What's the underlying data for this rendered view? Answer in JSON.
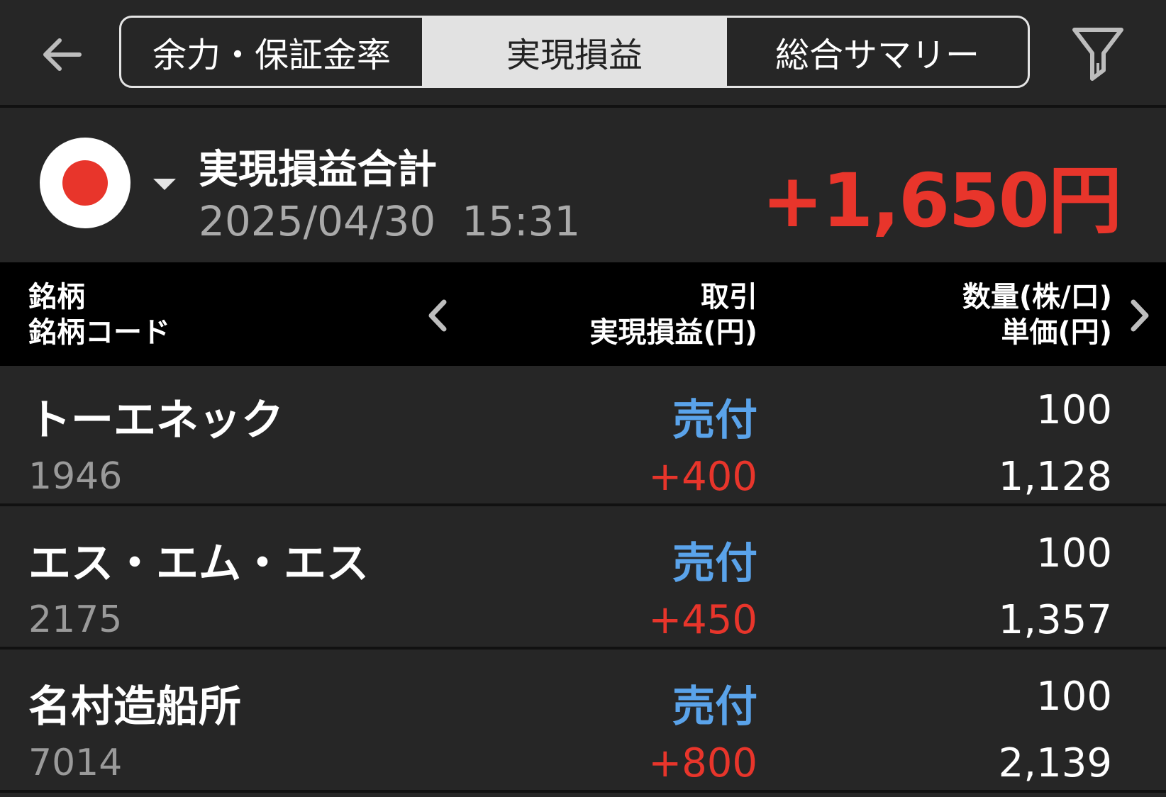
{
  "tabs": [
    {
      "label": "余力・保証金率",
      "active": false
    },
    {
      "label": "実現損益",
      "active": true
    },
    {
      "label": "総合サマリー",
      "active": false
    }
  ],
  "summary": {
    "market_flag": "japan-flag-icon",
    "title": "実現損益合計",
    "datetime": "2025/04/30  15:31",
    "total": "+1,650円"
  },
  "table_header": {
    "col1_line1": "銘柄",
    "col1_line2": "銘柄コード",
    "col2_line1": "取引",
    "col2_line2": "実現損益(円)",
    "col3_line1": "数量(株/口)",
    "col3_line2": "単価(円)"
  },
  "rows": [
    {
      "name": "トーエネック",
      "code": "1946",
      "type": "売付",
      "pl": "+400",
      "qty": "100",
      "price": "1,128"
    },
    {
      "name": "エス・エム・エス",
      "code": "2175",
      "type": "売付",
      "pl": "+450",
      "qty": "100",
      "price": "1,357"
    },
    {
      "name": "名村造船所",
      "code": "7014",
      "type": "売付",
      "pl": "+800",
      "qty": "100",
      "price": "2,139"
    }
  ],
  "colors": {
    "positive": "#e8352b",
    "trade_type": "#5aa3ea",
    "background": "#262626"
  }
}
